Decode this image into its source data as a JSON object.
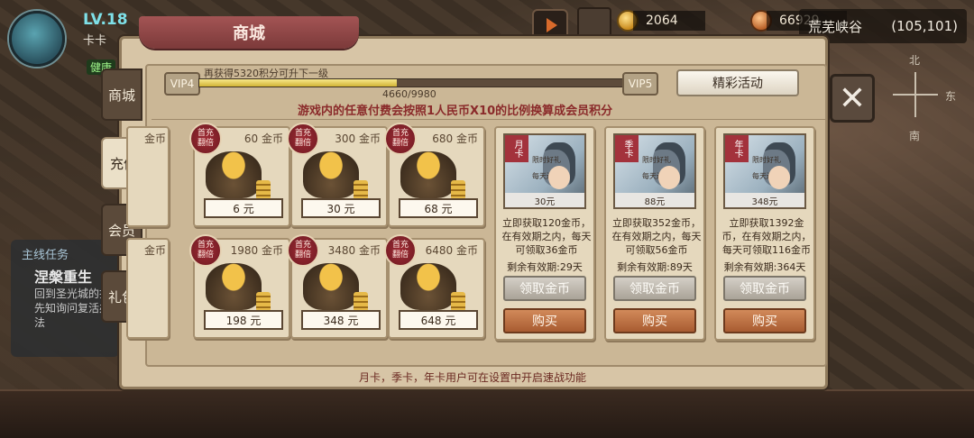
{
  "hud": {
    "level": "LV.18",
    "player_name": "卡卡",
    "health_tag": "健康",
    "gold": "2064",
    "copper": "66929",
    "location_name": "荒芜峡谷",
    "location_coords": "(105,101)",
    "compass": {
      "north": "北",
      "east": "东",
      "south": "南"
    }
  },
  "quest": {
    "section_title": "主线任务",
    "name": "涅槃重生",
    "desc": "回到圣光城的找先知询问复活办法"
  },
  "store": {
    "title": "商城",
    "tabs": [
      "商城",
      "充值",
      "会员",
      "礼包"
    ],
    "active_tab": "充值",
    "vip_current": "VIP4",
    "vip_next": "VIP5",
    "vip_hint": "再获得5320积分可升下一级",
    "vip_progress": "4660/9980",
    "vip_fraction": 0.467,
    "notice": "游戏内的任意付费会按照1人民币X10的比例换算成会员积分",
    "event_button": "精彩活动",
    "gold_packs": [
      {
        "amount": "60 金币",
        "price": "6 元",
        "badge": "首充翻倍"
      },
      {
        "amount": "300 金币",
        "price": "30 元",
        "badge": "首充翻倍"
      },
      {
        "amount": "680 金币",
        "price": "68 元",
        "badge": "首充翻倍"
      },
      {
        "amount": "1980 金币",
        "price": "198 元",
        "badge": "首充翻倍"
      },
      {
        "amount": "3480 金币",
        "price": "348 元",
        "badge": "首充翻倍"
      },
      {
        "amount": "6480 金币",
        "price": "648 元",
        "badge": "首充翻倍"
      }
    ],
    "partial_col": [
      "金币",
      "金币"
    ],
    "cards": [
      {
        "type": "月卡",
        "price": "30元",
        "sign1": "限时好礼",
        "sign2": "每天送金币",
        "desc": "立即获取120金币，在有效期之内，每天可领取36金币",
        "remain": "剩余有效期:29天",
        "claim": "领取金币",
        "buy": "购买"
      },
      {
        "type": "季卡",
        "price": "88元",
        "sign1": "限时好礼",
        "sign2": "每天送金币",
        "desc": "立即获取352金币，在有效期之内，每天可领取56金币",
        "remain": "剩余有效期:89天",
        "claim": "领取金币",
        "buy": "购买"
      },
      {
        "type": "年卡",
        "price": "348元",
        "sign1": "限时好礼",
        "sign2": "每天送金币",
        "desc": "立即获取1392金币，在有效期之内，每天可领取116金币",
        "remain": "剩余有效期:364天",
        "claim": "领取金币",
        "buy": "购买"
      }
    ],
    "footer": "月卡，季卡，年卡用户可在设置中开启速战功能"
  },
  "colors": {
    "accent_red": "#7c3a3a",
    "buy_orange": "#a85b31",
    "notice_red": "#8a2a2a"
  }
}
